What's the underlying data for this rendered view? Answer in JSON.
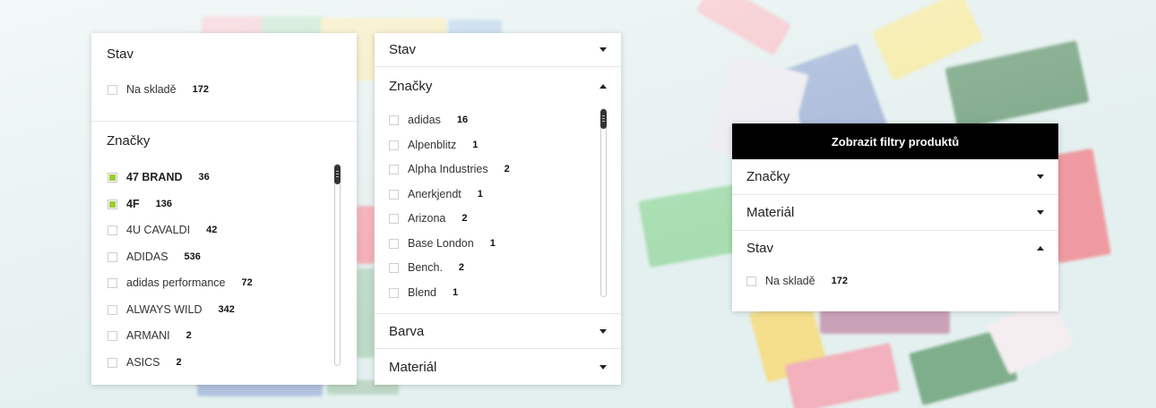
{
  "panel_left": {
    "stav": {
      "title": "Stav",
      "items": [
        {
          "label": "Na skladě",
          "count": "172",
          "checked": false
        }
      ]
    },
    "znacky": {
      "title": "Značky",
      "items": [
        {
          "label": "47 BRAND",
          "count": "36",
          "checked": true
        },
        {
          "label": "4F",
          "count": "136",
          "checked": true
        },
        {
          "label": "4U CAVALDI",
          "count": "42",
          "checked": false
        },
        {
          "label": "ADIDAS",
          "count": "536",
          "checked": false
        },
        {
          "label": "adidas performance",
          "count": "72",
          "checked": false
        },
        {
          "label": "ALWAYS WILD",
          "count": "342",
          "checked": false
        },
        {
          "label": "ARMANI",
          "count": "2",
          "checked": false
        },
        {
          "label": "ASICS",
          "count": "2",
          "checked": false
        }
      ]
    }
  },
  "panel_middle": {
    "stav_title": "Stav",
    "znacky": {
      "title": "Značky",
      "items": [
        {
          "label": "adidas",
          "count": "16"
        },
        {
          "label": "Alpenblitz",
          "count": "1"
        },
        {
          "label": "Alpha Industries",
          "count": "2"
        },
        {
          "label": "Anerkjendt",
          "count": "1"
        },
        {
          "label": "Arizona",
          "count": "2"
        },
        {
          "label": "Base London",
          "count": "1"
        },
        {
          "label": "Bench.",
          "count": "2"
        },
        {
          "label": "Blend",
          "count": "1"
        }
      ]
    },
    "barva_title": "Barva",
    "material_title": "Materiál"
  },
  "panel_right": {
    "header": "Zobrazit filtry produktů",
    "znacky_title": "Značky",
    "material_title": "Materiál",
    "stav": {
      "title": "Stav",
      "items": [
        {
          "label": "Na skladě",
          "count": "172"
        }
      ]
    }
  },
  "colors": {
    "checked_fill": "#9acd32",
    "header_bg": "#000000",
    "background": "#e4f0ef"
  }
}
